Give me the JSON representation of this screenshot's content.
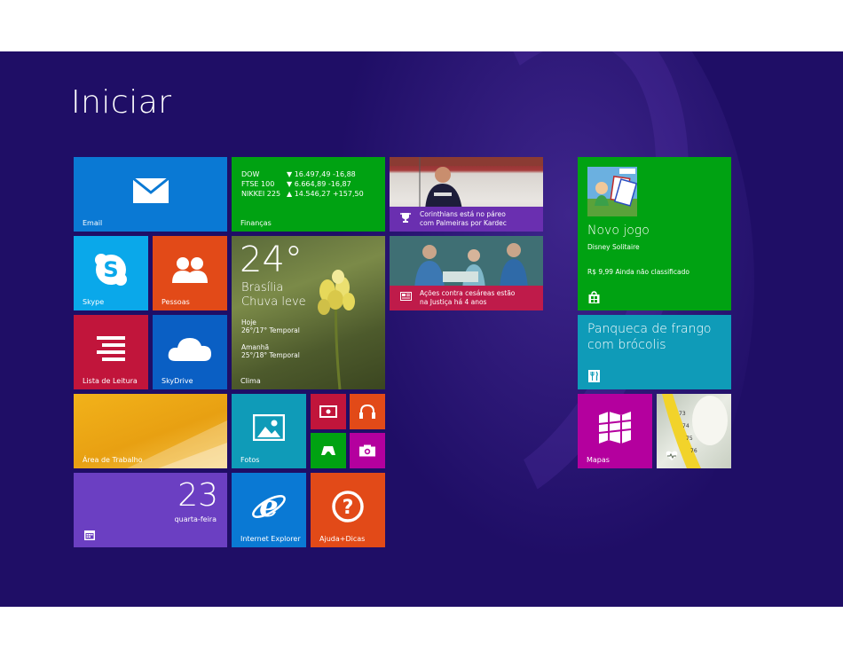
{
  "start": {
    "title": "Iniciar"
  },
  "tiles": {
    "mail": {
      "label": "Email",
      "icon": "mail-icon",
      "color": "#0a79d4"
    },
    "finance": {
      "label": "Finanças",
      "color": "#00a212",
      "rows": [
        {
          "name": "DOW",
          "arrow": "▼",
          "value": "16.497,49",
          "change": "-16,88"
        },
        {
          "name": "FTSE 100",
          "arrow": "▼",
          "value": "6.664,89",
          "change": "-16,87"
        },
        {
          "name": "NIKKEI 225",
          "arrow": "▲",
          "value": "14.546,27",
          "change": "+157,50"
        }
      ]
    },
    "sports": {
      "headline_1": "Corinthians está no páreo",
      "headline_2": "com Palmeiras por Kardec",
      "icon": "trophy-icon",
      "color": "#6a2fb0"
    },
    "health": {
      "headline_1": "Ações contra cesáreas estão",
      "headline_2": "na Justiça há 4 anos",
      "icon": "news-icon",
      "color": "#bf1b4a"
    },
    "store": {
      "title": "Novo jogo",
      "app": "Disney Solitaire",
      "price": "R$ 9,99 Ainda não classificado",
      "icon": "store-icon",
      "color": "#00a212"
    },
    "skype": {
      "label": "Skype",
      "icon": "skype-icon",
      "color": "#0aa8ea"
    },
    "people": {
      "label": "Pessoas",
      "icon": "people-icon",
      "color": "#e24a18"
    },
    "weather": {
      "label": "Clima",
      "temp": "24°",
      "city": "Brasília",
      "condition": "Chuva leve",
      "today_label": "Hoje",
      "today": "26°/17° Temporal",
      "tomorrow_label": "Amanhã",
      "tomorrow": "25°/18° Temporal"
    },
    "food": {
      "title_1": "Panqueca de frango",
      "title_2": "com brócolis",
      "icon": "fork-knife-icon",
      "color": "#0f9bb8"
    },
    "reading": {
      "label": "Lista de Leitura",
      "icon": "reading-list-icon",
      "color": "#c1153b"
    },
    "skydrive": {
      "label": "SkyDrive",
      "icon": "cloud-icon",
      "color": "#0a5fc4"
    },
    "desktop": {
      "label": "Área de Trabalho"
    },
    "photos": {
      "label": "Fotos",
      "icon": "photo-icon",
      "color": "#0f9bb8"
    },
    "video": {
      "icon": "video-icon",
      "color": "#c1153b"
    },
    "music": {
      "icon": "headphones-icon",
      "color": "#e24a18"
    },
    "games": {
      "icon": "gamepad-icon",
      "color": "#00a212"
    },
    "camera": {
      "icon": "camera-icon",
      "color": "#b4009e"
    },
    "maps": {
      "label": "Mapas",
      "icon": "map-icon",
      "color": "#b4009e"
    },
    "calendar": {
      "day": "23",
      "weekday": "quarta-feira",
      "icon": "calendar-icon",
      "color": "#6b3fc2"
    },
    "ie": {
      "label": "Internet Explorer",
      "icon": "internet-explorer-icon",
      "color": "#0a79d4"
    },
    "help": {
      "label": "Ajuda+Dicas",
      "icon": "help-icon",
      "color": "#e24a18"
    }
  }
}
